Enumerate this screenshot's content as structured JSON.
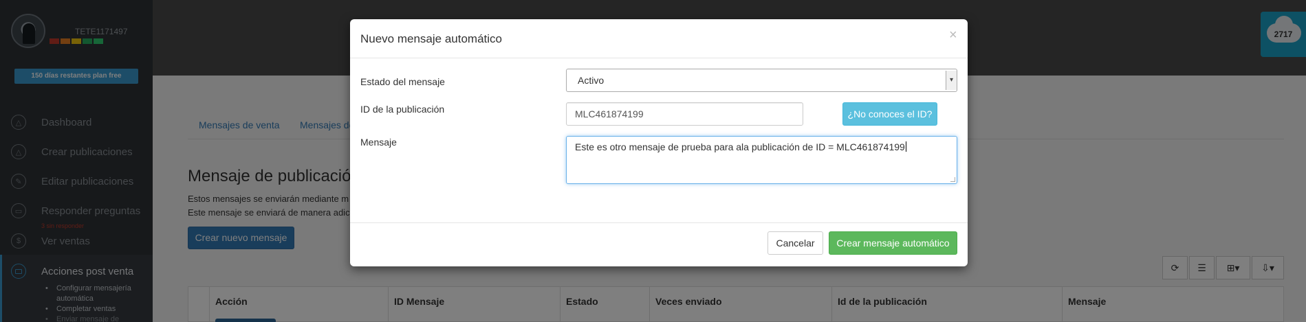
{
  "sidebar": {
    "username": "TETE1171497",
    "reputation_colors": [
      "#c0392b",
      "#e67e22",
      "#f1c40f",
      "#27ae60",
      "#2ecc71"
    ],
    "plan_badge": "150 días restantes plan free",
    "nav": [
      {
        "label": "Dashboard",
        "icon": "triangle-icon"
      },
      {
        "label": "Crear publicaciones",
        "icon": "triangle-icon"
      },
      {
        "label": "Editar publicaciones",
        "icon": "pencil-icon"
      },
      {
        "label": "Responder preguntas",
        "icon": "chat-icon"
      },
      {
        "label": "Ver ventas",
        "icon": "dollar-icon"
      }
    ],
    "nav_sub": "3 sin responder",
    "active": {
      "label": "Acciones post venta",
      "icon": "envelope-icon"
    },
    "submenu": [
      "Configurar mensajería automática",
      "Completar ventas",
      "Enviar mensaje de"
    ]
  },
  "credits": {
    "value": "2717",
    "icon": "cloud-icon"
  },
  "main": {
    "tabs": [
      "Mensajes de venta",
      "Mensajes de"
    ],
    "section_title": "Mensaje de publicación",
    "desc_1": "Estos mensajes se enviarán mediante m",
    "desc_2": "Este mensaje se enviará de manera adic",
    "new_button": "Crear nuevo mensaje",
    "toolbar_icons": [
      "refresh-icon",
      "list-icon",
      "grid-icon",
      "export-icon"
    ],
    "table_headers": [
      "Acción",
      "ID Mensaje",
      "Estado",
      "Veces enviado",
      "Id de la publicación",
      "Mensaje"
    ]
  },
  "modal": {
    "title": "Nuevo mensaje automático",
    "close": "×",
    "status_label": "Estado del mensaje",
    "status_value": "Activo",
    "id_label": "ID de la publicación",
    "id_value": "MLC461874199",
    "id_help_button": "¿No conoces el ID?",
    "message_label": "Mensaje",
    "message_value": "Este es otro mensaje de prueba para ala publicación de ID = MLC461874199",
    "cancel_button": "Cancelar",
    "create_button": "Crear mensaje automático"
  }
}
